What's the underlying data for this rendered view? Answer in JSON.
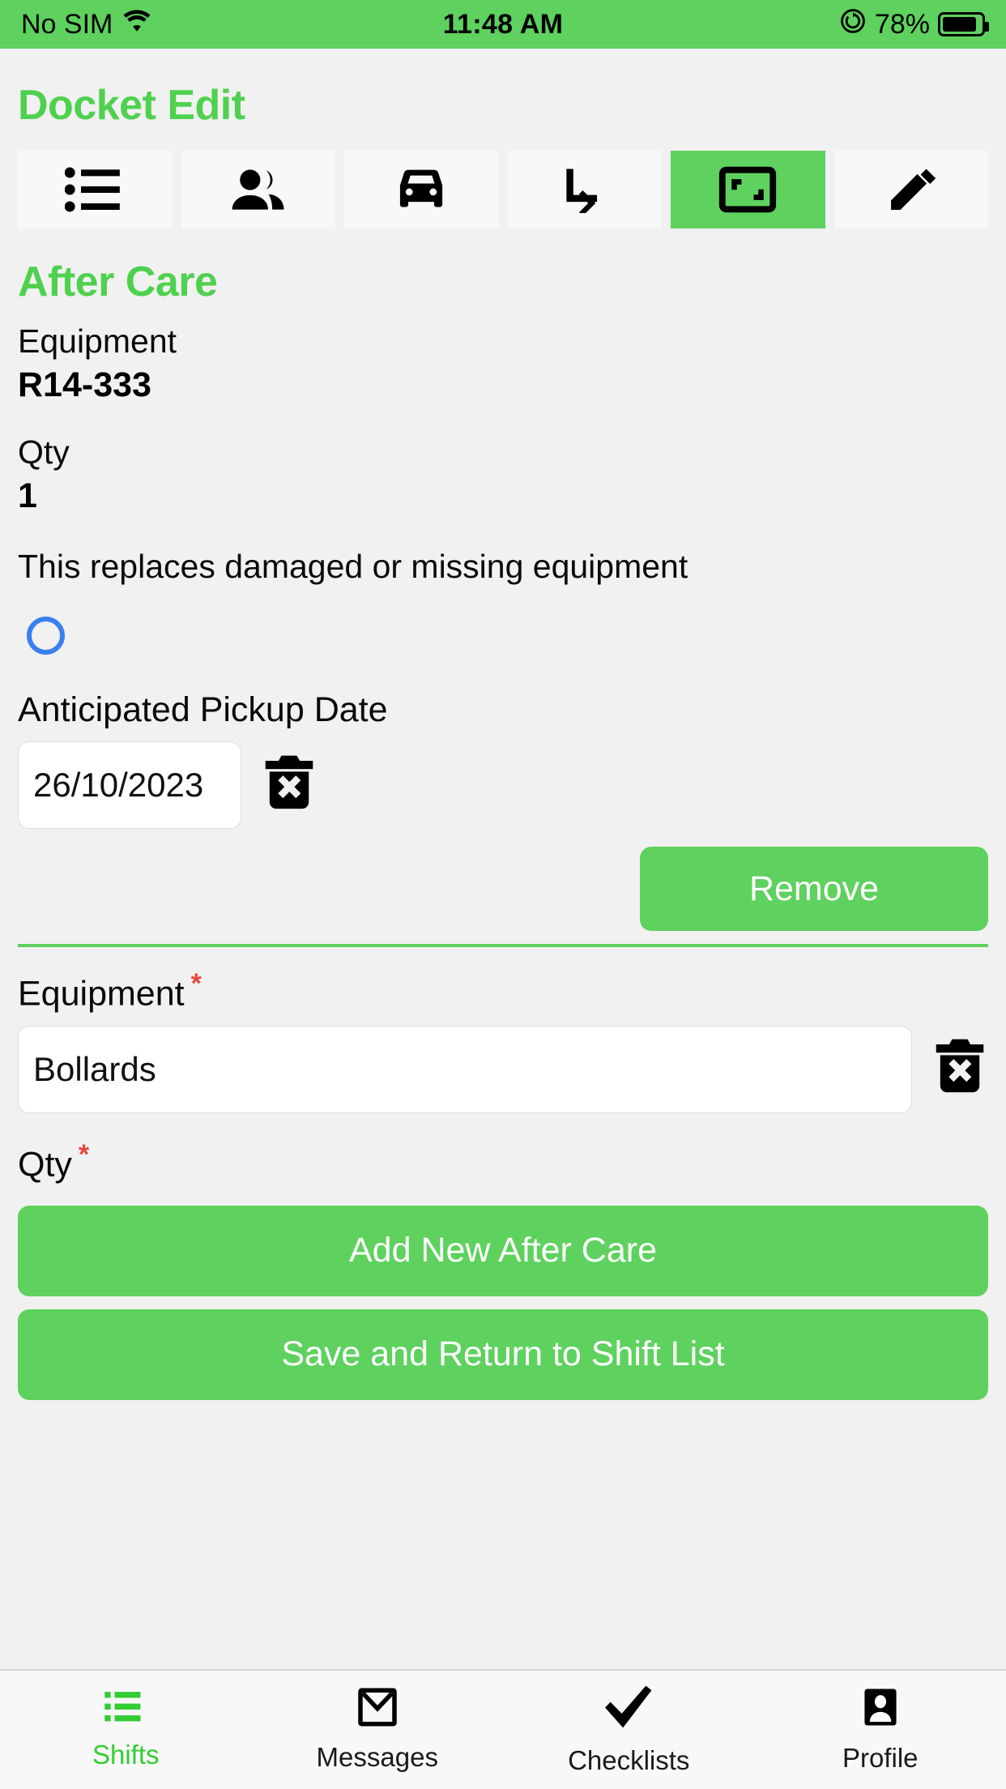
{
  "status_bar": {
    "carrier": "No SIM",
    "wifi_icon": "wifi-icon",
    "time": "11:48 AM",
    "rotation_lock_icon": "rotation-lock-icon",
    "battery_percent": "78%",
    "battery_icon": "battery-icon"
  },
  "header": {
    "title": "Docket Edit"
  },
  "tabs": [
    {
      "icon": "list-bullet-icon",
      "name": "tab-list",
      "active": false
    },
    {
      "icon": "people-icon",
      "name": "tab-crew",
      "active": false
    },
    {
      "icon": "car-icon",
      "name": "tab-vehicle",
      "active": false
    },
    {
      "icon": "subdirectory-arrow-right-icon",
      "name": "tab-tasks",
      "active": false
    },
    {
      "icon": "expand-frame-icon",
      "name": "tab-after-care",
      "active": true
    },
    {
      "icon": "pencil-icon",
      "name": "tab-notes",
      "active": false
    }
  ],
  "section": {
    "title": "After Care"
  },
  "existing_item": {
    "equipment_label": "Equipment",
    "equipment_value": "R14-333",
    "qty_label": "Qty",
    "qty_value": "1",
    "replacement_note": "This replaces damaged or missing equipment",
    "replacement_checked": false,
    "pickup_date_label": "Anticipated Pickup Date",
    "pickup_date_value": "26/10/2023",
    "delete_date_icon": "trash-delete-icon",
    "remove_button": "Remove"
  },
  "new_item": {
    "equipment_label": "Equipment",
    "equipment_required": "*",
    "equipment_value": "Bollards",
    "delete_icon": "trash-delete-icon",
    "qty_label": "Qty",
    "qty_required": "*"
  },
  "actions": {
    "add_new": "Add New After Care",
    "save_return": "Save and Return to Shift List"
  },
  "bottom_nav": [
    {
      "label": "Shifts",
      "icon": "list-icon",
      "active": true
    },
    {
      "label": "Messages",
      "icon": "envelope-icon",
      "active": false
    },
    {
      "label": "Checklists",
      "icon": "check-icon",
      "active": false
    },
    {
      "label": "Profile",
      "icon": "contact-card-icon",
      "active": false
    }
  ],
  "colors": {
    "brand_green": "#5ed15e",
    "title_green": "#4fd14f",
    "required_red": "#e8453c",
    "radio_blue": "#3a7ff0",
    "page_background": "#f1f1f1"
  }
}
